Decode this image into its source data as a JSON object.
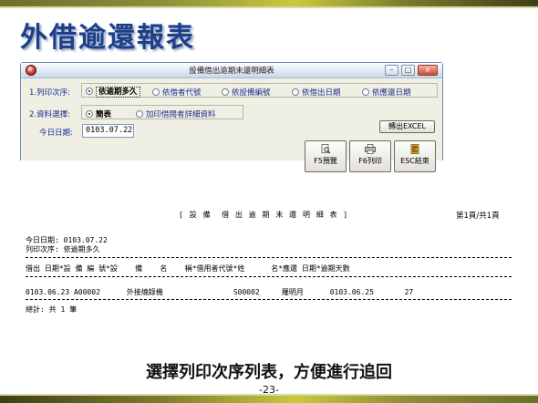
{
  "slide": {
    "title": "外借逾還報表",
    "caption": "選擇列印次序列表，方便進行追回",
    "page_number": "-23-"
  },
  "window": {
    "title": "設備借出逾期未還明細表",
    "controls": {
      "minimize": "–",
      "maximize": "□",
      "close": "×"
    }
  },
  "form": {
    "print_order": {
      "label": "1.列印次序:",
      "options": [
        "依逾期多久",
        "依借者代號",
        "依設備編號",
        "依借出日期",
        "依應還日期"
      ],
      "selected": "依逾期多久"
    },
    "data_select": {
      "label": "2.資料選擇:",
      "options": [
        "簡表",
        "加印借閱者詳細資料"
      ],
      "selected": "簡表"
    },
    "today": {
      "label": "今日日期:",
      "value": "0103.07.22"
    },
    "buttons": {
      "excel": "轉出EXCEL",
      "preview": "F5預覽",
      "print": "F6列印",
      "exit": "ESC結束"
    }
  },
  "report": {
    "title": "[ 設 備  借 出 逾 期 未 還 明 細 表 ]",
    "page": "第1頁/共1頁",
    "today_line": "今日日期: 0103.07.22",
    "order_line": "列印次序: 依逾期多久",
    "header": "借出 日期*設 備 編 號*設    備    名    稱*借用者代號*姓      名*應還 日期*逾期天數",
    "rows": [
      "0103.06.23 A00002      外接燒錄機                S00002     羅明月      0103.06.25       27"
    ],
    "total": "總計: 共 1 筆"
  }
}
